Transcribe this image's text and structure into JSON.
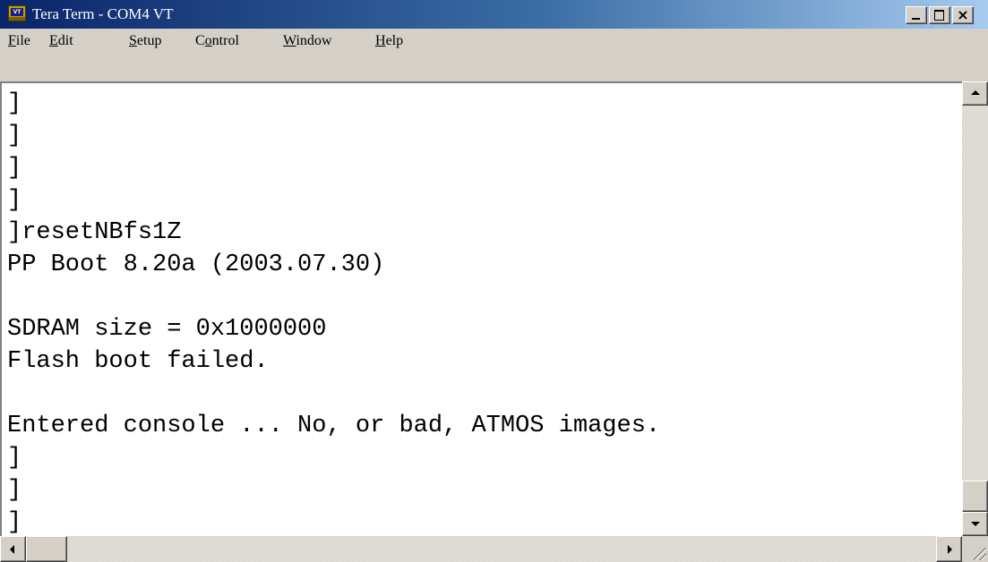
{
  "window": {
    "title": "Tera Term - COM4 VT",
    "close_glyph": "×"
  },
  "menu": {
    "items": [
      {
        "accel": "F",
        "rest": "ile"
      },
      {
        "accel": "E",
        "rest": "dit"
      },
      {
        "accel": "S",
        "rest": "etup"
      },
      {
        "pre": "C",
        "accel": "o",
        "rest": "ntrol"
      },
      {
        "accel": "W",
        "rest": "indow"
      },
      {
        "accel": "H",
        "rest": "elp"
      }
    ]
  },
  "terminal": {
    "lines": [
      "]",
      "]",
      "]",
      "]",
      "]resetNBfs1Z",
      "PP Boot 8.20a (2003.07.30)",
      "",
      "SDRAM size = 0x1000000",
      "Flash boot failed.",
      "",
      "Entered console ... No, or bad, ATMOS images.",
      "]",
      "]",
      "]"
    ]
  },
  "icons": {
    "app": "teraterm-app-icon",
    "minimize": "minimize-icon",
    "maximize": "maximize-icon",
    "close": "close-icon",
    "scroll_up": "arrow-up-icon",
    "scroll_down": "arrow-down-icon",
    "scroll_left": "arrow-left-icon",
    "scroll_right": "arrow-right-icon"
  },
  "app_icon_text": "VT"
}
